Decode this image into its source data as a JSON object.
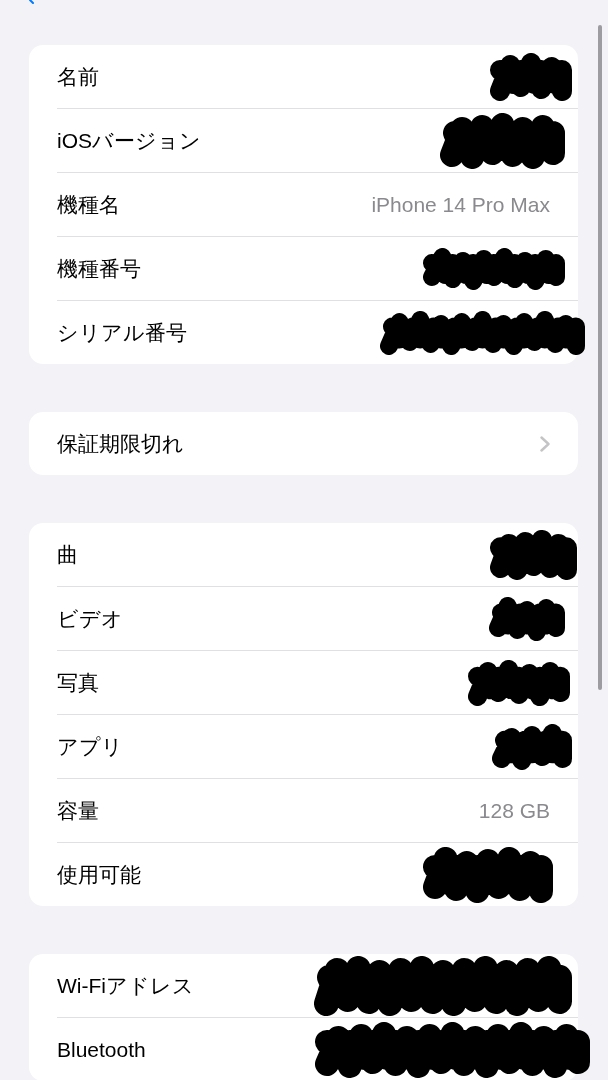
{
  "sections": [
    {
      "rows": [
        {
          "kind": "redacted",
          "label": "名前"
        },
        {
          "kind": "redacted",
          "label": "iOSバージョン"
        },
        {
          "kind": "value",
          "label": "機種名",
          "value": "iPhone 14 Pro Max"
        },
        {
          "kind": "redacted",
          "label": "機種番号"
        },
        {
          "kind": "redacted",
          "label": "シリアル番号"
        }
      ]
    },
    {
      "rows": [
        {
          "kind": "disclosure",
          "label": "保証期限切れ"
        }
      ]
    },
    {
      "rows": [
        {
          "kind": "redacted",
          "label": "曲"
        },
        {
          "kind": "redacted",
          "label": "ビデオ"
        },
        {
          "kind": "redacted",
          "label": "写真"
        },
        {
          "kind": "redacted",
          "label": "アプリ"
        },
        {
          "kind": "value",
          "label": "容量",
          "value": "128 GB"
        },
        {
          "kind": "redacted",
          "label": "使用可能"
        }
      ]
    },
    {
      "rows": [
        {
          "kind": "redacted",
          "label": "Wi-Fiアドレス"
        },
        {
          "kind": "redacted",
          "label": "Bluetooth"
        }
      ]
    }
  ]
}
